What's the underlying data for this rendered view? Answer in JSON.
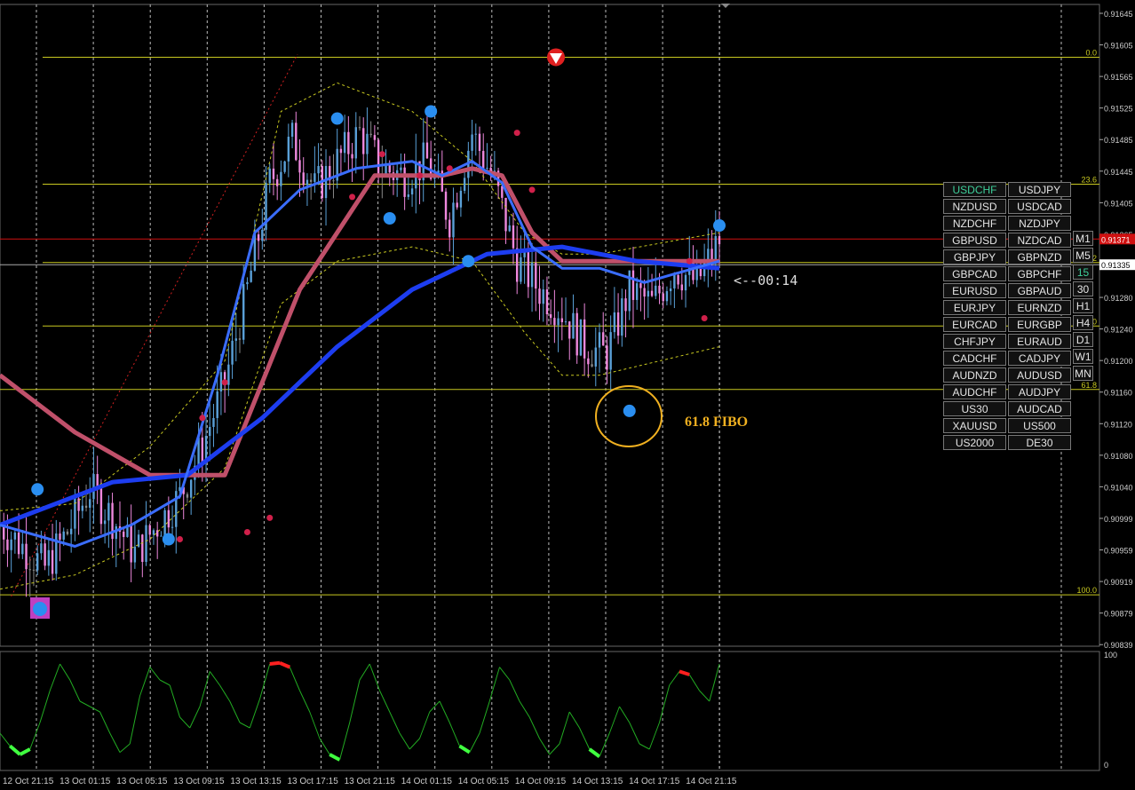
{
  "chart_data": [
    {
      "type": "candlestick",
      "symbol": "USDCHF",
      "ylim": [
        0.908,
        0.917
      ],
      "price_ticks": [
        "0.91645",
        "0.91605",
        "0.91565",
        "0.91525",
        "0.91485",
        "0.91445",
        "0.91405",
        "0.91365",
        "0.91320",
        "0.91280",
        "0.91240",
        "0.91200",
        "0.91160",
        "0.91120",
        "0.91080",
        "0.91040",
        "0.90999",
        "0.90959",
        "0.90919",
        "0.90879",
        "0.90839"
      ],
      "time_labels": [
        "12 Oct 21:15",
        "13 Oct 01:15",
        "13 Oct 05:15",
        "13 Oct 09:15",
        "13 Oct 13:15",
        "13 Oct 17:15",
        "13 Oct 21:15",
        "14 Oct 01:15",
        "14 Oct 05:15",
        "14 Oct 09:15",
        "14 Oct 13:15",
        "14 Oct 17:15",
        "14 Oct 21:15"
      ],
      "fibo_levels": [
        {
          "label": "0.0",
          "price": 0.91626
        },
        {
          "label": "23.6",
          "price": 0.91448
        },
        {
          "label": "38.2",
          "price": 0.91338
        },
        {
          "label": "50.0",
          "price": 0.91249
        },
        {
          "label": "61.8",
          "price": 0.9116
        },
        {
          "label": "100.0",
          "price": 0.90872
        }
      ],
      "bid_price": {
        "label": "0.91371",
        "price": 0.91371,
        "color": "#d01010"
      },
      "ask_price": {
        "label": "0.91335",
        "price": 0.91335
      },
      "countdown": "<--00:14",
      "annotation": "61.8 FIBO",
      "annotation_color": "#f0b020",
      "series": [
        {
          "name": "close",
          "points": [
            [
              0,
              0.9097
            ],
            [
              6,
              0.9094
            ],
            [
              12,
              0.9091
            ],
            [
              18,
              0.9096
            ],
            [
              24,
              0.9102
            ],
            [
              30,
              0.9098
            ],
            [
              36,
              0.9093
            ],
            [
              42,
              0.9097
            ],
            [
              48,
              0.9101
            ],
            [
              54,
              0.9108
            ],
            [
              60,
              0.9117
            ],
            [
              66,
              0.913
            ],
            [
              72,
              0.9145
            ],
            [
              78,
              0.9151
            ],
            [
              84,
              0.9144
            ],
            [
              90,
              0.9148
            ],
            [
              96,
              0.9152
            ],
            [
              102,
              0.9147
            ],
            [
              108,
              0.9146
            ],
            [
              114,
              0.9148
            ],
            [
              120,
              0.914
            ],
            [
              126,
              0.9152
            ],
            [
              132,
              0.9145
            ],
            [
              138,
              0.9134
            ],
            [
              144,
              0.913
            ],
            [
              150,
              0.9127
            ],
            [
              156,
              0.9122
            ],
            [
              162,
              0.9121
            ],
            [
              168,
              0.913
            ],
            [
              174,
              0.9128
            ],
            [
              180,
              0.9133
            ],
            [
              186,
              0.9131
            ],
            [
              192,
              0.9137
            ]
          ]
        },
        {
          "name": "ma_fast",
          "points": [
            [
              0,
              0.9097
            ],
            [
              20,
              0.9094
            ],
            [
              35,
              0.9097
            ],
            [
              48,
              0.9101
            ],
            [
              58,
              0.9118
            ],
            [
              68,
              0.9138
            ],
            [
              80,
              0.9144
            ],
            [
              95,
              0.9147
            ],
            [
              110,
              0.9148
            ],
            [
              118,
              0.9146
            ],
            [
              126,
              0.9148
            ],
            [
              134,
              0.9145
            ],
            [
              142,
              0.9136
            ],
            [
              150,
              0.9133
            ],
            [
              160,
              0.9133
            ],
            [
              172,
              0.9131
            ],
            [
              192,
              0.9134
            ]
          ]
        },
        {
          "name": "ma_slow",
          "points": [
            [
              0,
              0.9097
            ],
            [
              30,
              0.9103
            ],
            [
              50,
              0.9104
            ],
            [
              70,
              0.9112
            ],
            [
              90,
              0.9122
            ],
            [
              110,
              0.913
            ],
            [
              130,
              0.9135
            ],
            [
              150,
              0.9136
            ],
            [
              170,
              0.9134
            ],
            [
              192,
              0.9133
            ]
          ]
        },
        {
          "name": "ma_red",
          "points": [
            [
              0,
              0.9118
            ],
            [
              20,
              0.911
            ],
            [
              40,
              0.9104
            ],
            [
              55,
              0.9104
            ],
            [
              60,
              0.9104
            ],
            [
              80,
              0.913
            ],
            [
              100,
              0.9146
            ],
            [
              118,
              0.9146
            ],
            [
              126,
              0.9147
            ],
            [
              134,
              0.9146
            ],
            [
              142,
              0.9138
            ],
            [
              150,
              0.9134
            ],
            [
              170,
              0.9134
            ],
            [
              192,
              0.9134
            ]
          ]
        },
        {
          "name": "band_upper",
          "points": [
            [
              0,
              0.9099
            ],
            [
              20,
              0.91
            ],
            [
              40,
              0.9108
            ],
            [
              60,
              0.912
            ],
            [
              75,
              0.9155
            ],
            [
              90,
              0.9159
            ],
            [
              110,
              0.9155
            ],
            [
              126,
              0.9148
            ],
            [
              140,
              0.9138
            ],
            [
              150,
              0.9135
            ],
            [
              160,
              0.9135
            ],
            [
              192,
              0.9138
            ]
          ]
        },
        {
          "name": "band_lower",
          "points": [
            [
              0,
              0.9088
            ],
            [
              20,
              0.909
            ],
            [
              40,
              0.9095
            ],
            [
              60,
              0.9105
            ],
            [
              75,
              0.9128
            ],
            [
              90,
              0.9134
            ],
            [
              110,
              0.9136
            ],
            [
              126,
              0.9134
            ],
            [
              140,
              0.9124
            ],
            [
              150,
              0.9118
            ],
            [
              160,
              0.9118
            ],
            [
              192,
              0.9122
            ]
          ]
        }
      ],
      "signals_blue": [
        [
          10,
          0.9102
        ],
        [
          45,
          0.9095
        ],
        [
          90,
          0.9154
        ],
        [
          115,
          0.9155
        ],
        [
          104,
          0.914
        ],
        [
          125,
          0.9134
        ],
        [
          168,
          0.9113
        ],
        [
          192,
          0.9139
        ]
      ],
      "signals_red": [
        [
          48,
          0.9095
        ],
        [
          54,
          0.9112
        ],
        [
          60,
          0.9117
        ],
        [
          66,
          0.9096
        ],
        [
          72,
          0.9098
        ],
        [
          94,
          0.9143
        ],
        [
          102,
          0.9149
        ],
        [
          112,
          0.9146
        ],
        [
          120,
          0.9147
        ],
        [
          138,
          0.9152
        ],
        [
          142,
          0.9144
        ],
        [
          184,
          0.9134
        ],
        [
          188,
          0.9126
        ]
      ]
    },
    {
      "type": "line",
      "name": "oscillator",
      "ylim": [
        0,
        100
      ],
      "ticks": [
        "100",
        "0"
      ],
      "values": [
        30,
        18,
        10,
        15,
        40,
        70,
        95,
        80,
        60,
        55,
        50,
        30,
        12,
        20,
        65,
        92,
        80,
        75,
        45,
        35,
        55,
        88,
        75,
        60,
        40,
        35,
        62,
        95,
        96,
        92,
        70,
        50,
        25,
        10,
        5,
        40,
        80,
        95,
        70,
        50,
        30,
        15,
        25,
        50,
        60,
        40,
        18,
        12,
        30,
        60,
        92,
        80,
        60,
        45,
        25,
        10,
        20,
        50,
        35,
        15,
        8,
        30,
        55,
        40,
        20,
        15,
        40,
        75,
        88,
        85,
        70,
        60,
        95
      ]
    }
  ],
  "symbols": [
    [
      "USDCHF",
      "USDJPY"
    ],
    [
      "NZDUSD",
      "USDCAD"
    ],
    [
      "NZDCHF",
      "NZDJPY"
    ],
    [
      "GBPUSD",
      "NZDCAD"
    ],
    [
      "GBPJPY",
      "GBPNZD"
    ],
    [
      "GBPCAD",
      "GBPCHF"
    ],
    [
      "EURUSD",
      "GBPAUD"
    ],
    [
      "EURJPY",
      "EURNZD"
    ],
    [
      "EURCAD",
      "EURGBP"
    ],
    [
      "CHFJPY",
      "EURAUD"
    ],
    [
      "CADCHF",
      "CADJPY"
    ],
    [
      "AUDNZD",
      "AUDUSD"
    ],
    [
      "AUDCHF",
      "AUDJPY"
    ],
    [
      "US30",
      "AUDCAD"
    ],
    [
      "XAUUSD",
      "US500"
    ],
    [
      "US2000",
      "DE30"
    ]
  ],
  "active_symbol": "USDCHF",
  "timeframes": [
    "M1",
    "M5",
    "15",
    "30",
    "H1",
    "H4",
    "D1",
    "W1",
    "MN"
  ],
  "active_timeframe": "15",
  "colors": {
    "fibo": "#c8c820",
    "bull": "#5aa0d8",
    "bear": "#ee88dd",
    "neutral": "#888888",
    "ma_fast": "#3a6dff",
    "ma_slow": "#1d3df0",
    "ma_red": "#c0506a",
    "signal_blue": "#2a8ef0",
    "signal_red": "#d0204a",
    "osc": "#22aa22",
    "osc_hot": "#ff2020",
    "osc_cold": "#40ff40"
  }
}
